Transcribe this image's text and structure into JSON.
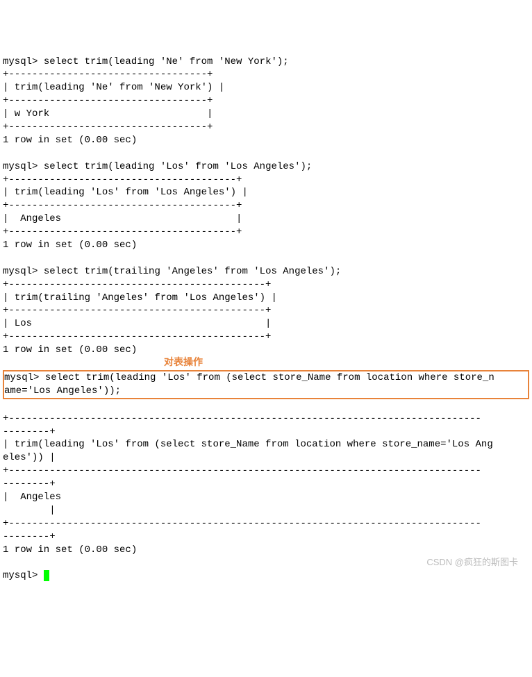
{
  "query1": {
    "prompt": "mysql> ",
    "sql": "select trim(leading 'Ne' from 'New York');",
    "sep1": "+----------------------------------+",
    "header": "| trim(leading 'Ne' from 'New York') |",
    "sep2": "+----------------------------------+",
    "row": "| w York                           |",
    "sep3": "+----------------------------------+",
    "footer": "1 row in set (0.00 sec)"
  },
  "query2": {
    "prompt": "mysql> ",
    "sql": "select trim(leading 'Los' from 'Los Angeles');",
    "sep1": "+---------------------------------------+",
    "header": "| trim(leading 'Los' from 'Los Angeles') |",
    "sep2": "+---------------------------------------+",
    "row": "|  Angeles                              |",
    "sep3": "+---------------------------------------+",
    "footer": "1 row in set (0.00 sec)"
  },
  "query3": {
    "prompt": "mysql> ",
    "sql": "select trim(trailing 'Angeles' from 'Los Angeles');",
    "sep1": "+--------------------------------------------+",
    "header": "| trim(trailing 'Angeles' from 'Los Angeles') |",
    "sep2": "+--------------------------------------------+",
    "row": "| Los                                        |",
    "sep3": "+--------------------------------------------+",
    "footer": "1 row in set (0.00 sec)"
  },
  "annotation": "对表操作",
  "query4": {
    "prompt": "mysql> ",
    "sql_line1": "select trim(leading 'Los' from (select store_Name from location where store_n",
    "sql_line2": "ame='Los Angeles'));",
    "sep1a": "+---------------------------------------------------------------------------------",
    "sep1b": "--------+",
    "header_a": "| trim(leading 'Los' from (select store_Name from location where store_name='Los Ang",
    "header_b": "eles')) |",
    "sep2a": "+---------------------------------------------------------------------------------",
    "sep2b": "--------+",
    "row_a": "|  Angeles                                                                          ",
    "row_b": "        |",
    "sep3a": "+---------------------------------------------------------------------------------",
    "sep3b": "--------+",
    "footer": "1 row in set (0.00 sec)"
  },
  "final_prompt": "mysql> ",
  "watermark": "CSDN @疯狂的斯图卡"
}
